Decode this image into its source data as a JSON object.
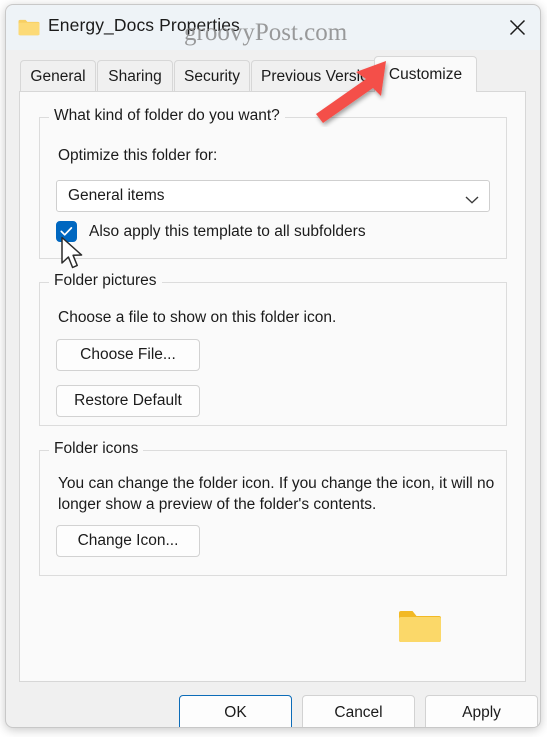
{
  "window": {
    "title": "Energy_Docs Properties",
    "folder_icon": "folder-icon",
    "close_label": "✕",
    "watermark": "groovyPost.com"
  },
  "tabs": [
    {
      "label": "General",
      "active": false
    },
    {
      "label": "Sharing",
      "active": false
    },
    {
      "label": "Security",
      "active": false
    },
    {
      "label": "Previous Versions",
      "active": false
    },
    {
      "label": "Customize",
      "active": true
    }
  ],
  "groups": {
    "folder_kind": {
      "legend": "What kind of folder do you want?",
      "prompt": "Optimize this folder for:",
      "combo": {
        "value": "General items",
        "chevron": "chevron-down-icon"
      },
      "checkbox": {
        "label": "Also apply this template to all subfolders",
        "checked": true
      }
    },
    "folder_pictures": {
      "legend": "Folder pictures",
      "description": "Choose a file to show on this folder icon.",
      "choose_file_label": "Choose File...",
      "restore_default_label": "Restore Default"
    },
    "folder_icons": {
      "legend": "Folder icons",
      "description_line1": "You can change the folder icon. If you change the icon, it will no",
      "description_line2": "longer show a preview of the folder's contents.",
      "change_icon_label": "Change Icon...",
      "preview_icon": "folder-icon"
    }
  },
  "footer": {
    "ok_label": "OK",
    "cancel_label": "Cancel",
    "apply_label": "Apply"
  },
  "annotations": {
    "arrow_color": "#f4504a",
    "arrow_name": "red-pointer-arrow"
  },
  "colors": {
    "accent": "#0067c0",
    "titlebar": "#eef3f7",
    "dialog_bg": "#f0f0f0",
    "panel_bg": "#fafafa",
    "folder_yellow": "#fbd046",
    "arrow_red": "#f4504a"
  }
}
